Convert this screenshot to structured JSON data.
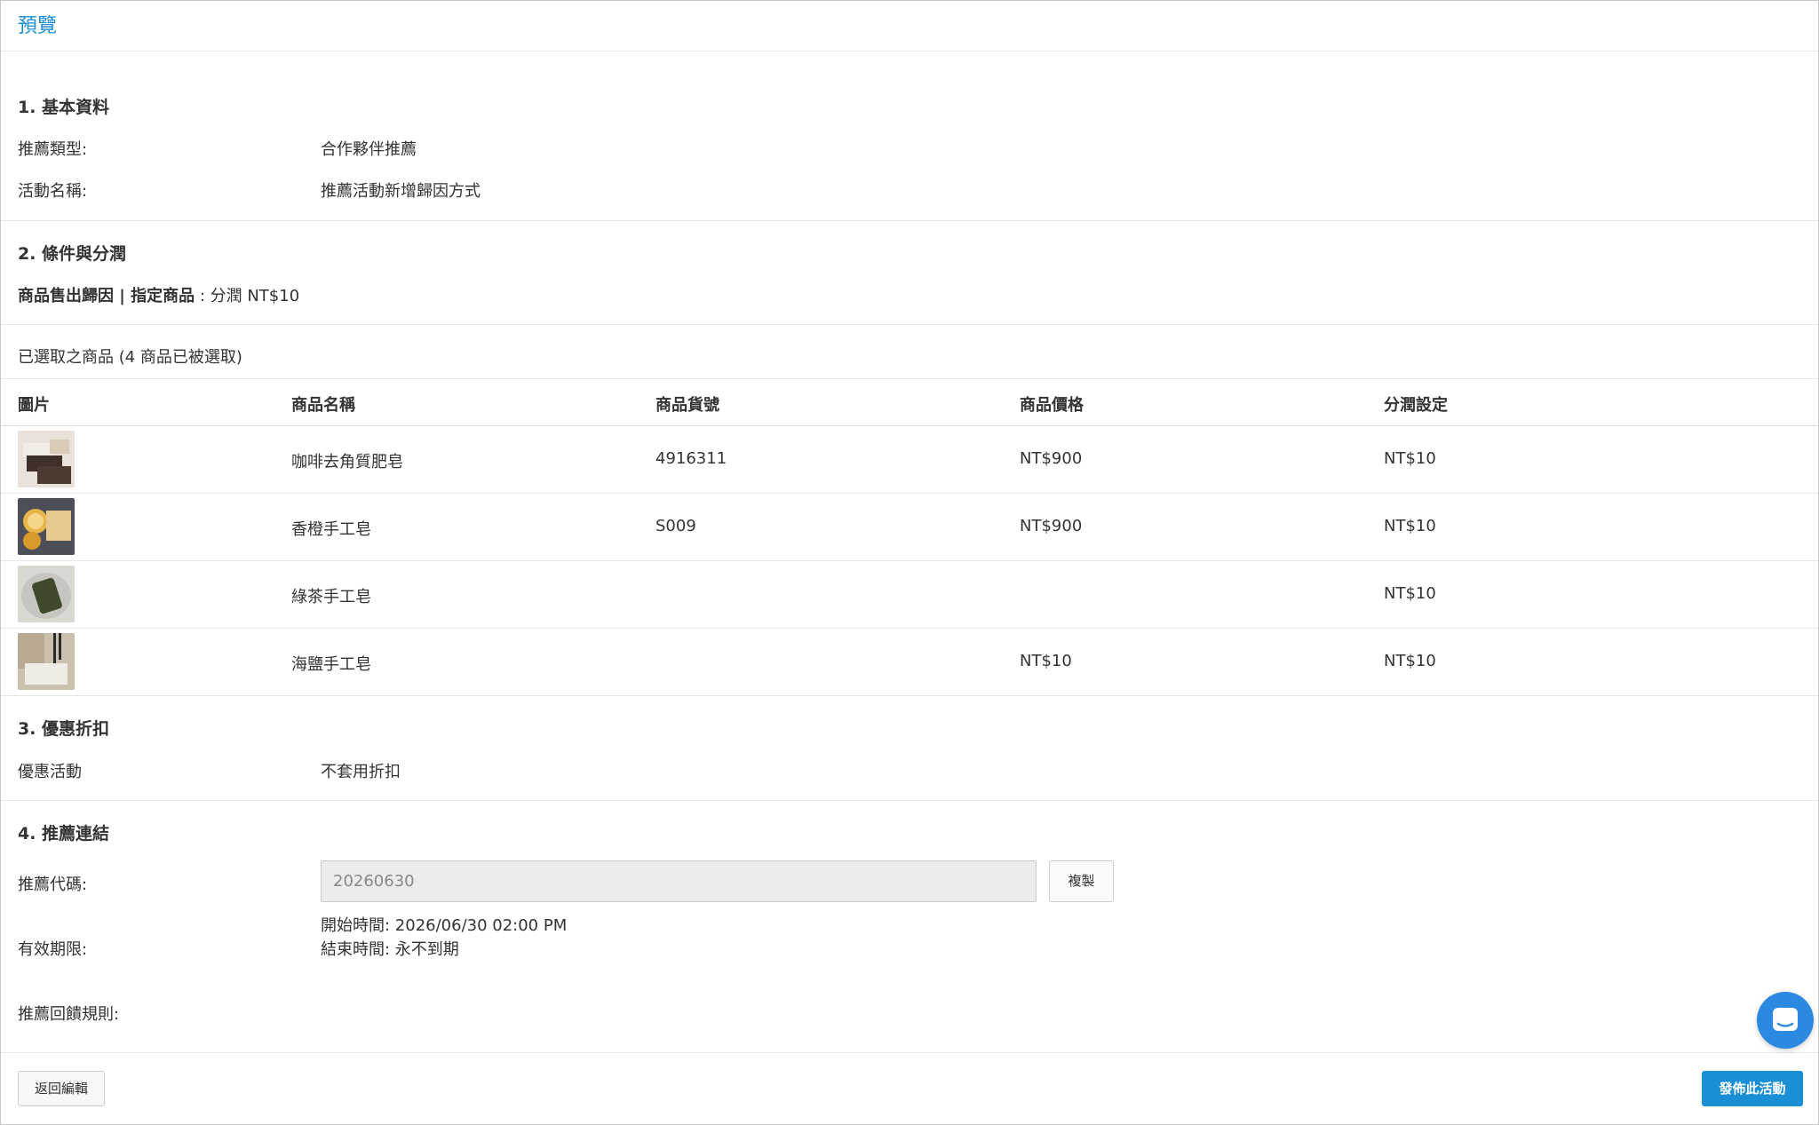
{
  "header": {
    "title": "預覽"
  },
  "basic": {
    "title": "1. 基本資料",
    "rows": [
      {
        "label": "推薦類型:",
        "value": "合作夥伴推薦"
      },
      {
        "label": "活動名稱:",
        "value": "推薦活動新增歸因方式"
      }
    ]
  },
  "conditions": {
    "title": "2. 條件與分潤",
    "rule_bold": "商品售出歸因 | 指定商品",
    "rule_rest": " : 分潤 NT$10"
  },
  "selected": {
    "caption": "已選取之商品 (4 商品已被選取)",
    "columns": [
      "圖片",
      "商品名稱",
      "商品貨號",
      "商品價格",
      "分潤設定"
    ],
    "rows": [
      {
        "name": "咖啡去角質肥皂",
        "sku": "4916311",
        "price": "NT$900",
        "commission": "NT$10"
      },
      {
        "name": "香橙手工皂",
        "sku": "S009",
        "price": "NT$900",
        "commission": "NT$10"
      },
      {
        "name": "綠茶手工皂",
        "sku": "",
        "price": "",
        "commission": "NT$10"
      },
      {
        "name": "海鹽手工皂",
        "sku": "",
        "price": "NT$10",
        "commission": "NT$10"
      }
    ]
  },
  "discount": {
    "title": "3. 優惠折扣",
    "label": "優惠活動",
    "value": "不套用折扣"
  },
  "link": {
    "title": "4. 推薦連結",
    "code_label": "推薦代碼:",
    "code_value": "20260630",
    "copy_label": "複製",
    "validity_label": "有效期限:",
    "start": "開始時間: 2026/06/30 02:00 PM",
    "end": "結束時間: 永不到期",
    "feedback_label": "推薦回饋規則:"
  },
  "footer": {
    "back_label": "返回編輯",
    "publish_label": "發佈此活動"
  },
  "colors": {
    "accent": "#1a8fd6"
  }
}
